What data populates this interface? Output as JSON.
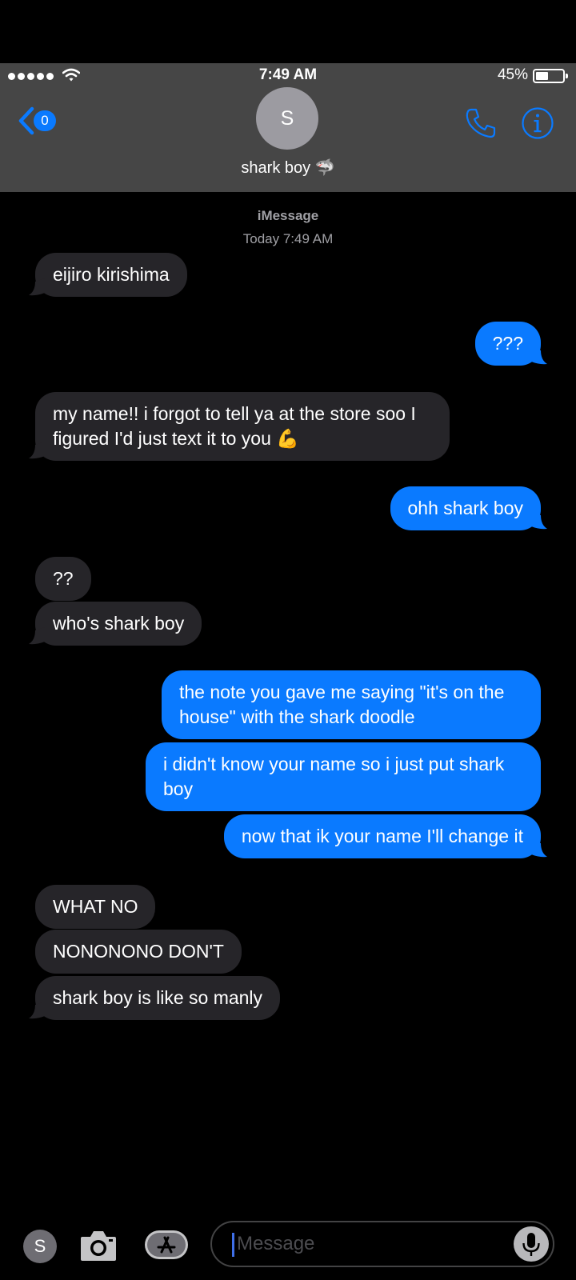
{
  "status_bar": {
    "time": "7:49 AM",
    "battery_percent": "45%",
    "battery_level": 0.45
  },
  "header": {
    "back_badge": "0",
    "avatar_initial": "S",
    "contact_name": "shark boy 🦈"
  },
  "thread": {
    "service": "iMessage",
    "timestamp": "Today 7:49 AM",
    "messages": [
      {
        "from": "them",
        "text": "eijiro kirishima"
      },
      {
        "from": "me",
        "text": "???"
      },
      {
        "from": "them",
        "text": "my name!! i forgot to tell ya at the store soo I figured I'd just text it to you 💪"
      },
      {
        "from": "me",
        "text": "ohh shark boy"
      },
      {
        "from": "them",
        "text": "??"
      },
      {
        "from": "them",
        "text": "who's shark boy"
      },
      {
        "from": "me",
        "text": "the note you gave me saying \"it's on the house\" with the shark doodle"
      },
      {
        "from": "me",
        "text": "i didn't know your name so i just put shark boy"
      },
      {
        "from": "me",
        "text": "now that ik your name I'll change it"
      },
      {
        "from": "them",
        "text": "WHAT NO"
      },
      {
        "from": "them",
        "text": "NONONONO DON'T"
      },
      {
        "from": "them",
        "text": "shark boy is like so manly"
      }
    ]
  },
  "input_bar": {
    "apps_avatar_initial": "S",
    "placeholder": "Message"
  },
  "colors": {
    "outgoing_bubble": "#0a7aff",
    "incoming_bubble": "#262529",
    "header_bg": "#464646",
    "accent": "#0a7aff"
  }
}
